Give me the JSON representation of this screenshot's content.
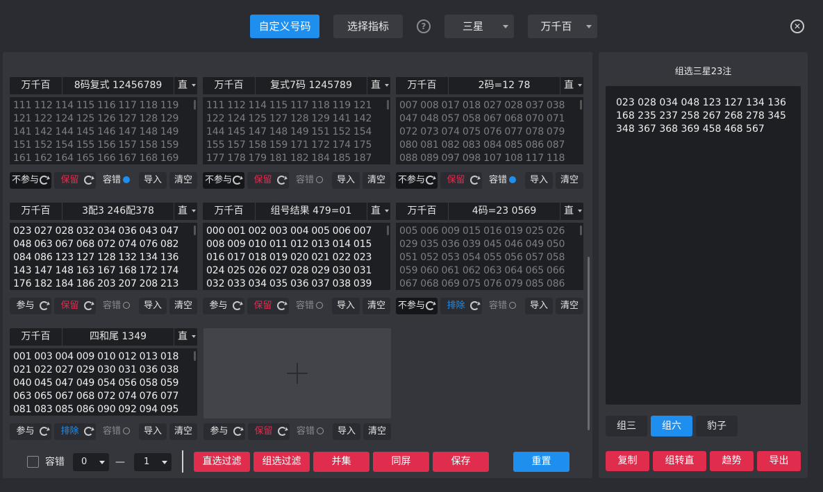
{
  "toolbar": {
    "custom_numbers": "自定义号码",
    "choose_indicator": "选择指标",
    "help_icon": "?",
    "select_type": "三星",
    "select_position": "万千百",
    "close_icon": "✕"
  },
  "cards": [
    {
      "pos": "万千百",
      "title": "8码复式 12456789",
      "mode": "直",
      "numbers": "111 112 114 115 116 117 118 119 121 122 124 125 126 127 128 129 141 142 144 145 146 147 148 149 151 152 154 155 156 157 158 159 161 162 164 165 166 167 168 169",
      "dim": true,
      "participate": "不参与",
      "keep": "保留",
      "keep_color": "red",
      "tolerance": "容错",
      "tolerance_on": true,
      "import": "导入",
      "clear": "清空",
      "participate_dark": true
    },
    {
      "pos": "万千百",
      "title": "复式7码 1245789",
      "mode": "直",
      "numbers": "111 112 114 115 117 118 119 121 122 124 125 127 128 129 141 142 144 145 147 148 149 151 152 154 155 157 158 159 171 172 174 175 177 178 179 181 182 184 185 187",
      "dim": true,
      "participate": "不参与",
      "keep": "保留",
      "keep_color": "red",
      "tolerance": "容错",
      "tolerance_on": false,
      "import": "导入",
      "clear": "清空",
      "participate_dark": true
    },
    {
      "pos": "万千百",
      "title": "2码=12 78",
      "mode": "直",
      "numbers": "007 008 017 018 027 028 037 038 047 048 057 058 067 068 070 071 072 073 074 075 076 077 078 079 080 081 082 083 084 085 086 087 088 089 097 098 107 108 117 118",
      "dim": true,
      "participate": "不参与",
      "keep": "保留",
      "keep_color": "red",
      "tolerance": "容错",
      "tolerance_on": true,
      "import": "导入",
      "clear": "清空",
      "participate_dark": true
    },
    {
      "pos": "万千百",
      "title": "3配3 246配378",
      "mode": "直",
      "numbers": "023 027 028 032 034 036 043 047 048 063 067 068 072 074 076 082 084 086 123 127 128 132 134 136 143 147 148 163 167 168 172 174 176 182 184 186 203 207 208 213",
      "dim": false,
      "participate": "参与",
      "keep": "保留",
      "keep_color": "red",
      "tolerance": "容错",
      "tolerance_on": false,
      "import": "导入",
      "clear": "清空",
      "participate_dark": false
    },
    {
      "pos": "万千百",
      "title": "组号结果 479=01",
      "mode": "直",
      "numbers": "000 001 002 003 004 005 006 007 008 009 010 011 012 013 014 015 016 017 018 019 020 021 022 023 024 025 026 027 028 029 030 031 032 033 034 035 036 037 038 039",
      "dim": false,
      "participate": "参与",
      "keep": "保留",
      "keep_color": "red",
      "tolerance": "容错",
      "tolerance_on": false,
      "import": "导入",
      "clear": "清空",
      "participate_dark": false
    },
    {
      "pos": "万千百",
      "title": "4码=23 0569",
      "mode": "直",
      "numbers": "005 006 009 015 016 019 025 026 029 035 036 039 045 046 049 050 051 052 053 054 055 056 057 058 059 060 061 062 063 064 065 066 067 068 069 075 076 079 085 086",
      "dim": true,
      "participate": "不参与",
      "keep": "排除",
      "keep_color": "blue",
      "tolerance": "容错",
      "tolerance_on": false,
      "import": "导入",
      "clear": "清空",
      "participate_dark": true
    },
    {
      "pos": "万千百",
      "title": "四和尾 1349",
      "mode": "直",
      "numbers": "001 003 004 009 010 012 013 018 021 022 027 029 030 031 036 038 040 045 047 049 054 056 058 059 063 065 067 068 072 074 076 077 081 083 085 086 090 092 094 095",
      "dim": false,
      "participate": "参与",
      "keep": "排除",
      "keep_color": "blue",
      "tolerance": "容错",
      "tolerance_on": false,
      "import": "导入",
      "clear": "清空",
      "participate_dark": false
    }
  ],
  "extra_row": {
    "participate": "参与",
    "keep": "保留",
    "tolerance": "容错",
    "import": "导入",
    "clear": "清空"
  },
  "add_card": {
    "plus_icon": "+"
  },
  "bottom": {
    "tolerance_label": "容错",
    "min_value": "0",
    "dash": "—",
    "max_value": "1",
    "btn_direct_filter": "直选过滤",
    "btn_group_filter": "组选过滤",
    "btn_union": "并集",
    "btn_same_screen": "同屏",
    "btn_save": "保存",
    "btn_reset": "重置"
  },
  "right": {
    "title": "组选三星23注",
    "result": "023 028 034 048 123 127 134 136 168 235 237 258 267 268 278 345 348 367 368 369 458 468 567",
    "tab_group3": "组三",
    "tab_group6": "组六",
    "tab_leopard": "豹子",
    "btn_copy": "复制",
    "btn_to_direct": "组转直",
    "btn_trend": "趋势",
    "btn_export": "导出"
  },
  "colors": {
    "accent": "#1e8fef",
    "danger": "#e02d4e",
    "panel": "#35363c",
    "field": "#1e1f23"
  }
}
